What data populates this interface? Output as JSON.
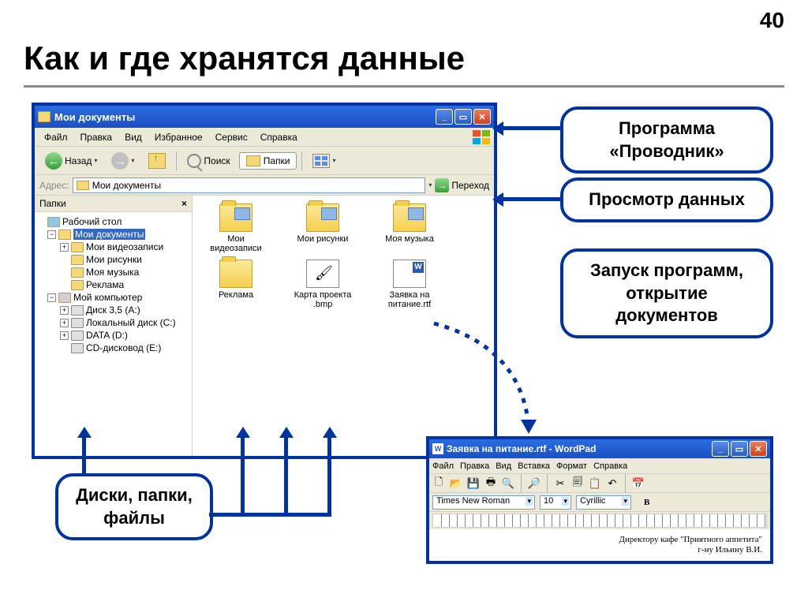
{
  "slide": {
    "number": "40",
    "title": "Как и где хранятся данные"
  },
  "explorer": {
    "title": "Мои документы",
    "menu": {
      "file": "Файл",
      "edit": "Правка",
      "view": "Вид",
      "favorites": "Избранное",
      "tools": "Сервис",
      "help": "Справка"
    },
    "toolbar": {
      "back": "Назад",
      "search": "Поиск",
      "folders": "Папки"
    },
    "address": {
      "label": "Адрес:",
      "value": "Мои документы",
      "go": "Переход"
    },
    "sidebar": {
      "title": "Папки"
    },
    "tree": {
      "desktop": "Рабочий стол",
      "mydocs": "Мои документы",
      "videos": "Мои видеозаписи",
      "pictures": "Мои рисунки",
      "music": "Моя музыка",
      "ads": "Реклама",
      "mycomputer": "Мой компьютер",
      "floppy": "Диск 3,5 (A:)",
      "localdisk": "Локальный диск (C:)",
      "data": "DATA (D:)",
      "cd": "CD-дисковод (E:)"
    },
    "items": {
      "videos": "Мои видеозаписи",
      "pictures": "Мои рисунки",
      "music": "Моя музыка",
      "ads": "Реклама",
      "bmp": "Карта проекта .bmp",
      "rtf": "Заявка на питание.rtf"
    }
  },
  "callouts": {
    "explorer_prog": "Программа «Проводник»",
    "view_data": "Просмотр данных",
    "launch": "Запуск программ, открытие документов",
    "disks": "Диски, папки, файлы"
  },
  "wordpad": {
    "title": "Заявка на питание.rtf - WordPad",
    "menu": {
      "file": "Файл",
      "edit": "Правка",
      "view": "Вид",
      "insert": "Вставка",
      "format": "Формат",
      "help": "Справка"
    },
    "format": {
      "font": "Times New Roman",
      "size": "10",
      "script": "Cyrillic",
      "bold": "B"
    },
    "doc": {
      "line1": "Директору кафе \"Приятного аппетита\"",
      "line2": "г-ну Ильину В.И."
    }
  }
}
